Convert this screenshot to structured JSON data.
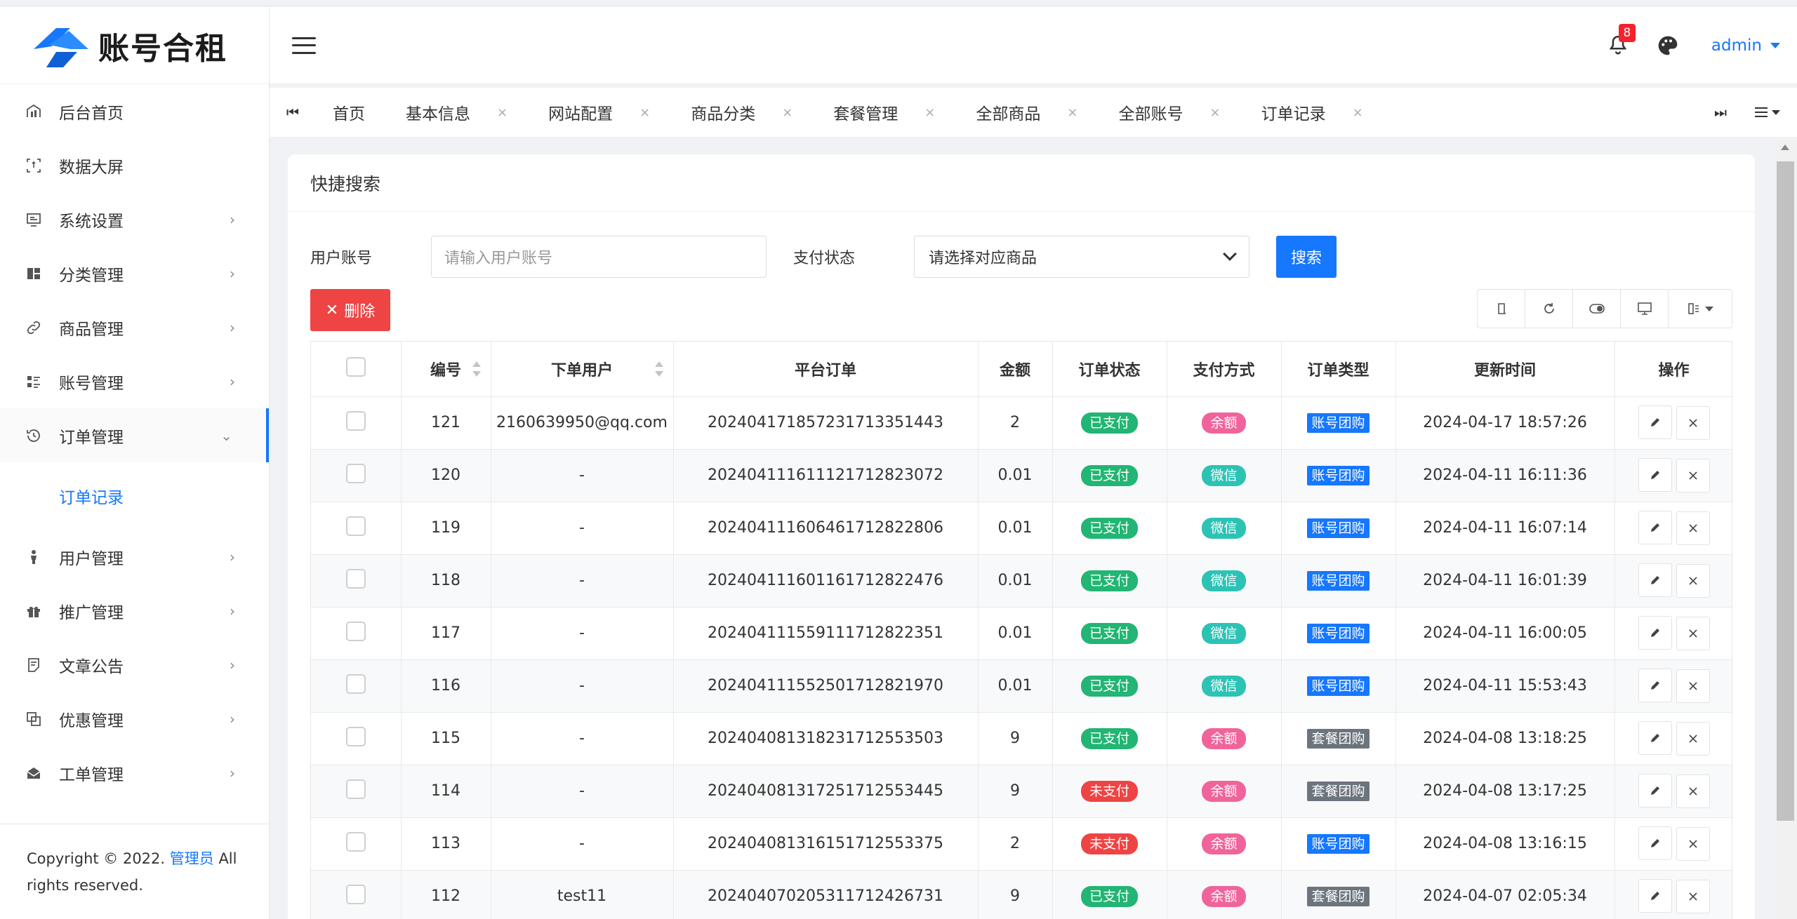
{
  "brand": {
    "name": "账号合租",
    "colors": {
      "primary": "#1677ff",
      "danger": "#ef4444",
      "success": "#22b573"
    }
  },
  "sidebar": {
    "items": [
      {
        "label": "后台首页",
        "icon": "dashboard-icon",
        "has_children": false
      },
      {
        "label": "数据大屏",
        "icon": "screen-icon",
        "has_children": false
      },
      {
        "label": "系统设置",
        "icon": "settings-icon",
        "has_children": true
      },
      {
        "label": "分类管理",
        "icon": "category-icon",
        "has_children": true
      },
      {
        "label": "商品管理",
        "icon": "link-icon",
        "has_children": true
      },
      {
        "label": "账号管理",
        "icon": "account-list-icon",
        "has_children": true
      },
      {
        "label": "订单管理",
        "icon": "history-icon",
        "has_children": true,
        "open": true
      }
    ],
    "submenu": {
      "label": "订单记录"
    },
    "items_after": [
      {
        "label": "用户管理",
        "icon": "user-icon"
      },
      {
        "label": "推广管理",
        "icon": "gift-icon"
      },
      {
        "label": "文章公告",
        "icon": "article-icon"
      },
      {
        "label": "优惠管理",
        "icon": "coupon-icon"
      },
      {
        "label": "工单管理",
        "icon": "ticket-icon"
      }
    ],
    "footer": {
      "prefix": "Copyright © 2022. ",
      "link": "管理员",
      "suffix": " All rights reserved."
    }
  },
  "topbar": {
    "notification_count": "8",
    "user": "admin"
  },
  "tabs": [
    {
      "label": "首页",
      "closable": false
    },
    {
      "label": "基本信息",
      "closable": true
    },
    {
      "label": "网站配置",
      "closable": true
    },
    {
      "label": "商品分类",
      "closable": true
    },
    {
      "label": "套餐管理",
      "closable": true
    },
    {
      "label": "全部商品",
      "closable": true
    },
    {
      "label": "全部账号",
      "closable": true
    },
    {
      "label": "订单记录",
      "closable": true,
      "active": true
    }
  ],
  "search": {
    "title": "快捷搜索",
    "user_label": "用户账号",
    "user_placeholder": "请输入用户账号",
    "pay_label": "支付状态",
    "pay_select": "请选择对应商品",
    "search_button": "搜索",
    "delete_button": "删除"
  },
  "table": {
    "columns": [
      "编号",
      "下单用户",
      "平台订单",
      "金额",
      "订单状态",
      "支付方式",
      "订单类型",
      "更新时间",
      "操作"
    ],
    "rows": [
      {
        "id": "121",
        "user": "2160639950@qq.com",
        "order": "20240417185723171335144З",
        "amount": "2",
        "status": "已支付",
        "status_type": "paid",
        "pay": "余额",
        "pay_type": "balance",
        "type": "账号团购",
        "type_kind": "acct",
        "time": "2024-04-17 18:57:26"
      },
      {
        "id": "120",
        "user": "-",
        "order": "202404111611121712823072",
        "amount": "0.01",
        "status": "已支付",
        "status_type": "paid",
        "pay": "微信",
        "pay_type": "wechat",
        "type": "账号团购",
        "type_kind": "acct",
        "time": "2024-04-11 16:11:36"
      },
      {
        "id": "119",
        "user": "-",
        "order": "202404111606461712822806",
        "amount": "0.01",
        "status": "已支付",
        "status_type": "paid",
        "pay": "微信",
        "pay_type": "wechat",
        "type": "账号团购",
        "type_kind": "acct",
        "time": "2024-04-11 16:07:14"
      },
      {
        "id": "118",
        "user": "-",
        "order": "202404111601161712822476",
        "amount": "0.01",
        "status": "已支付",
        "status_type": "paid",
        "pay": "微信",
        "pay_type": "wechat",
        "type": "账号团购",
        "type_kind": "acct",
        "time": "2024-04-11 16:01:39"
      },
      {
        "id": "117",
        "user": "-",
        "order": "202404111559111712822351",
        "amount": "0.01",
        "status": "已支付",
        "status_type": "paid",
        "pay": "微信",
        "pay_type": "wechat",
        "type": "账号团购",
        "type_kind": "acct",
        "time": "2024-04-11 16:00:05"
      },
      {
        "id": "116",
        "user": "-",
        "order": "202404111552501712821970",
        "amount": "0.01",
        "status": "已支付",
        "status_type": "paid",
        "pay": "微信",
        "pay_type": "wechat",
        "type": "账号团购",
        "type_kind": "acct",
        "time": "2024-04-11 15:53:43"
      },
      {
        "id": "115",
        "user": "-",
        "order": "202404081318231712553503",
        "amount": "9",
        "status": "已支付",
        "status_type": "paid",
        "pay": "余额",
        "pay_type": "balance",
        "type": "套餐团购",
        "type_kind": "pkg",
        "time": "2024-04-08 13:18:25"
      },
      {
        "id": "114",
        "user": "-",
        "order": "202404081317251712553445",
        "amount": "9",
        "status": "未支付",
        "status_type": "unpaid",
        "pay": "余额",
        "pay_type": "balance",
        "type": "套餐团购",
        "type_kind": "pkg",
        "time": "2024-04-08 13:17:25"
      },
      {
        "id": "113",
        "user": "-",
        "order": "202404081316151712553375",
        "amount": "2",
        "status": "未支付",
        "status_type": "unpaid",
        "pay": "余额",
        "pay_type": "balance",
        "type": "账号团购",
        "type_kind": "acct",
        "time": "2024-04-08 13:16:15"
      },
      {
        "id": "112",
        "user": "test11",
        "order": "202404070205311712426731",
        "amount": "9",
        "status": "已支付",
        "status_type": "paid",
        "pay": "余额",
        "pay_type": "balance",
        "type": "套餐团购",
        "type_kind": "pkg",
        "time": "2024-04-07 02:05:34"
      }
    ]
  }
}
